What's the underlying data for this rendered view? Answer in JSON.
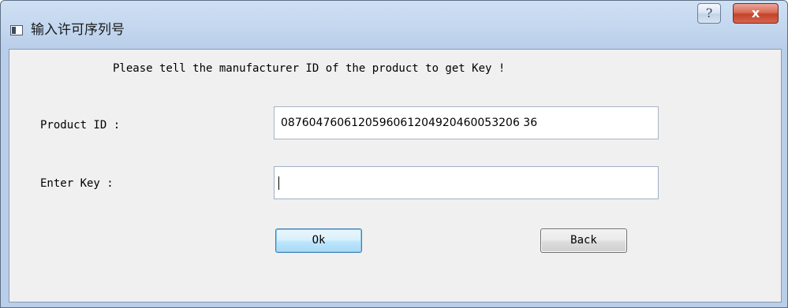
{
  "window": {
    "title": "输入许可序列号",
    "help_label": "?",
    "close_label": "x"
  },
  "dialog": {
    "instruction": "Please tell the manufacturer ID of the product to get Key !",
    "product_id_label": "Product ID :",
    "product_id_value": "0876047606120596061204920460053206 36",
    "enter_key_label": "Enter Key :",
    "enter_key_value": ""
  },
  "buttons": {
    "ok_label": "Ok",
    "back_label": "Back"
  },
  "colors": {
    "title_bar": "#c1d5ee",
    "client_background": "#f0f0f0",
    "close_button": "#c2442b",
    "default_button_border": "#3c7fb1"
  }
}
